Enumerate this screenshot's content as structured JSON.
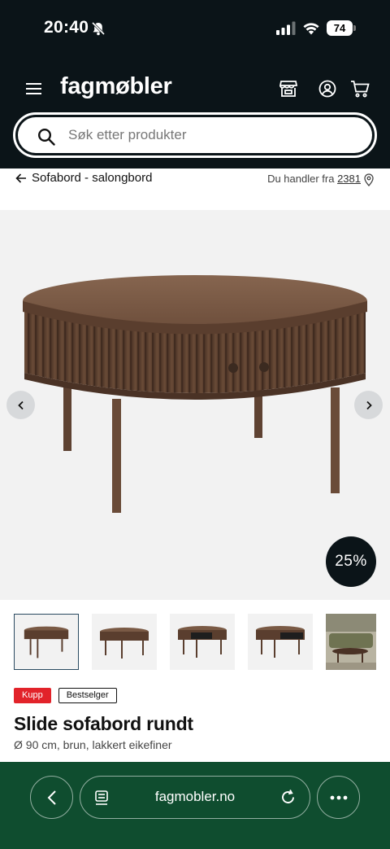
{
  "status_bar": {
    "time": "20:40",
    "battery": "74"
  },
  "header": {
    "logo": "fagmøbler",
    "search_placeholder": "Søk etter produkter"
  },
  "breadcrumb": {
    "label": "Sofabord - salongbord",
    "location_prefix": "Du handler fra",
    "zip": "2381"
  },
  "gallery": {
    "discount": "25%",
    "thumbnail_count": 5,
    "active_thumbnail": 1
  },
  "product": {
    "badges": [
      "Kupp",
      "Bestselger"
    ],
    "title": "Slide sofabord rundt",
    "subtitle": "Ø 90 cm, brun, lakkert eikefiner"
  },
  "browser": {
    "url": "fagmobler.no"
  },
  "colors": {
    "header_bg": "#0b1418",
    "browser_bar_bg": "#0f4d2f",
    "badge_red": "#e2232a",
    "wood": "#6b4c38"
  }
}
